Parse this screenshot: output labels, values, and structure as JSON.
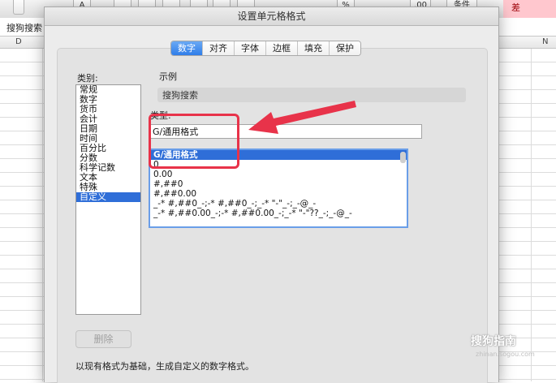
{
  "spreadsheet": {
    "toolbar_fragment_1": "A",
    "toolbar_percent": "%",
    "toolbar_decimal": ".00",
    "toolbar_condition": "条件",
    "bad_style_label": "差",
    "cell_content": "搜狗搜索",
    "columns": [
      "D",
      "N"
    ]
  },
  "dialog": {
    "title": "设置单元格格式",
    "tabs": [
      "数字",
      "对齐",
      "字体",
      "边框",
      "填充",
      "保护"
    ],
    "active_tab": "数字",
    "category_label": "类别:",
    "categories": [
      "常规",
      "数字",
      "货币",
      "会计",
      "日期",
      "时间",
      "百分比",
      "分数",
      "科学记数",
      "文本",
      "特殊",
      "自定义"
    ],
    "selected_category": "自定义",
    "sample_label": "示例",
    "sample_value": "搜狗搜索",
    "type_label": "类型:",
    "type_value": "G/通用格式",
    "formats": [
      "G/通用格式",
      "0",
      "0.00",
      "#,##0",
      "#,##0.00",
      "_-* #,##0_-;-* #,##0_-;_-* \"-\"_-;_-@_-",
      "_-* #,##0.00_-;-* #,##0.00_-;_-* \"-\"??_-;_-@_-"
    ],
    "delete_label": "删除",
    "description": "以现有格式为基础，生成自定义的数字格式。"
  },
  "annotation": {
    "color": "#e8334a"
  },
  "watermark": {
    "text": "搜狗指南",
    "url": "zhinan.sogou.com"
  }
}
